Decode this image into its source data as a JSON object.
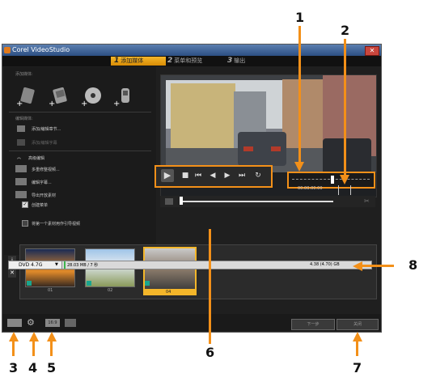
{
  "window": {
    "title": "Corel VideoStudio",
    "close_glyph": "✕"
  },
  "steps": [
    {
      "num": "1",
      "label": "添加媒体"
    },
    {
      "num": "2",
      "label": "菜单和预览"
    },
    {
      "num": "3",
      "label": "输出"
    }
  ],
  "left_panel": {
    "add_media_heading": "添加媒体:",
    "edit_media_heading": "编辑媒体:",
    "edit_items": [
      "添加/编辑章节...",
      "添加/编辑字幕"
    ],
    "advanced": "高级编辑",
    "advanced_items": [
      "多重修整视频...",
      "编辑字幕...",
      "导出开放素材"
    ],
    "checkbox_label": "创建菜单",
    "merge_label": "将第一个素材用作引导视频"
  },
  "preview": {
    "timecode": "00:00:00:00"
  },
  "thumbnails": [
    {
      "num": "01"
    },
    {
      "num": "02"
    },
    {
      "num": "04"
    }
  ],
  "status": {
    "disc": "DVD 4.7G",
    "used": "28.03 MB / 7 秒",
    "capacity": "4.38 (4.70) GB"
  },
  "buttons": {
    "next": "下一步",
    "close": "关闭"
  },
  "callouts": {
    "c1": "1",
    "c2": "2",
    "c3": "3",
    "c4": "4",
    "c5": "5",
    "c6": "6",
    "c7": "7",
    "c8": "8"
  },
  "colors": {
    "accent": "#f39019",
    "step_active": "#f4b62a"
  }
}
